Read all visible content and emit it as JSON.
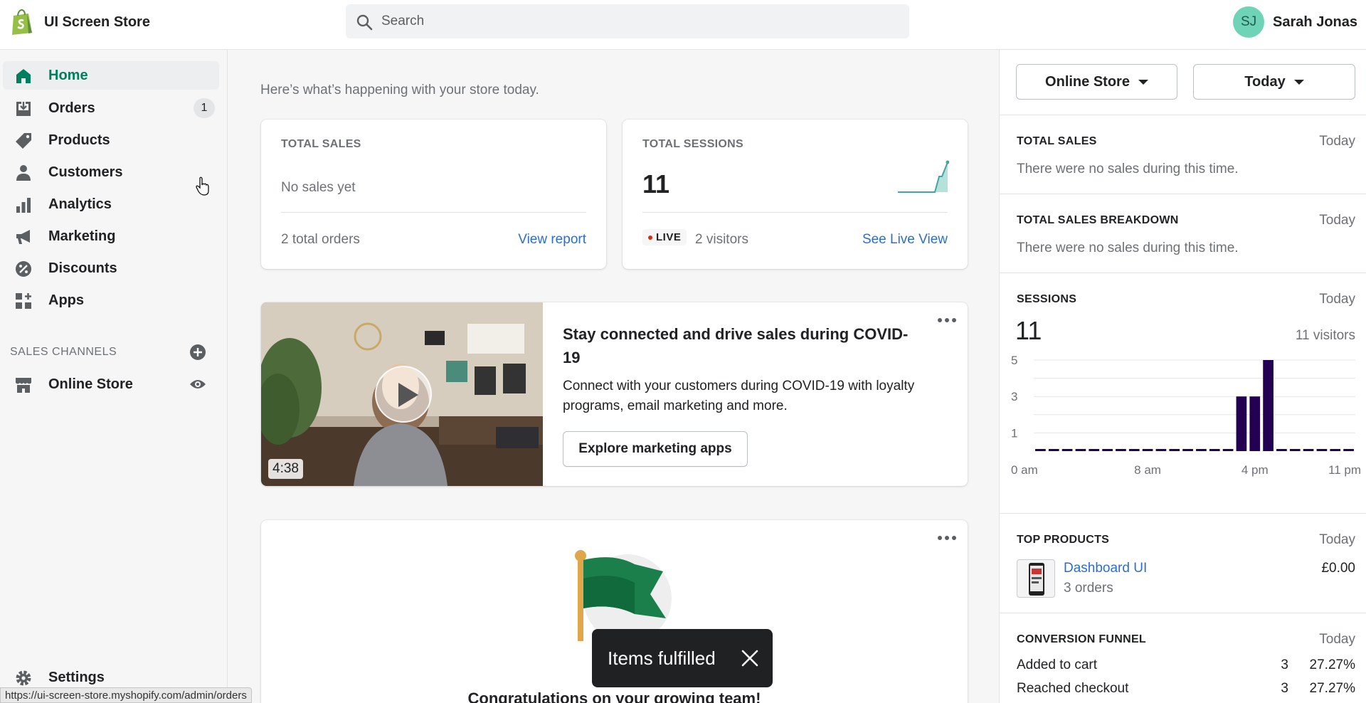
{
  "topbar": {
    "store_name": "UI Screen Store",
    "search_placeholder": "Search",
    "user_initials": "SJ",
    "user_name": "Sarah Jonas"
  },
  "sidebar": {
    "items": [
      {
        "label": "Home",
        "icon": "home-icon"
      },
      {
        "label": "Orders",
        "icon": "orders-icon",
        "badge": "1"
      },
      {
        "label": "Products",
        "icon": "tag-icon"
      },
      {
        "label": "Customers",
        "icon": "person-icon"
      },
      {
        "label": "Analytics",
        "icon": "bar-chart-icon"
      },
      {
        "label": "Marketing",
        "icon": "megaphone-icon"
      },
      {
        "label": "Discounts",
        "icon": "discount-icon"
      },
      {
        "label": "Apps",
        "icon": "apps-icon"
      }
    ],
    "sales_channels_label": "SALES CHANNELS",
    "online_store_label": "Online Store",
    "settings_label": "Settings"
  },
  "main": {
    "intro": "Here’s what’s happening with your store today.",
    "total_sales": {
      "heading": "TOTAL SALES",
      "value": "No sales yet",
      "orders": "2 total orders",
      "link": "View report"
    },
    "total_sessions": {
      "heading": "TOTAL SESSIONS",
      "value": "11",
      "live": "LIVE",
      "visitors": "2 visitors",
      "link": "See Live View"
    },
    "promo": {
      "duration": "4:38",
      "title": "Stay connected and drive sales during COVID-19",
      "body": "Connect with your customers during COVID-19 with loyalty programs, email marketing and more.",
      "button": "Explore marketing apps"
    },
    "team_card": {
      "title": "Congratulations on your growing team!"
    }
  },
  "toast": {
    "text": "Items fulfilled"
  },
  "statusbar": {
    "url": "https://ui-screen-store.myshopify.com/admin/orders"
  },
  "right_panel": {
    "channel_filter": "Online Store",
    "date_filter": "Today",
    "total_sales": {
      "heading": "TOTAL SALES",
      "date": "Today",
      "text": "There were no sales during this time."
    },
    "breakdown": {
      "heading": "TOTAL SALES BREAKDOWN",
      "date": "Today",
      "text": "There were no sales during this time."
    },
    "sessions": {
      "heading": "SESSIONS",
      "date": "Today",
      "value": "11",
      "visitors": "11 visitors"
    },
    "top_products": {
      "heading": "TOP PRODUCTS",
      "date": "Today",
      "product_name": "Dashboard UI",
      "product_orders": "3 orders",
      "product_price": "£0.00"
    },
    "conversion": {
      "heading": "CONVERSION FUNNEL",
      "date": "Today",
      "rows": [
        {
          "label": "Added to cart",
          "count": "3",
          "percent": "27.27%"
        },
        {
          "label": "Reached checkout",
          "count": "3",
          "percent": "27.27%"
        }
      ]
    }
  },
  "chart_data": {
    "type": "bar",
    "title": "",
    "x": [
      0,
      1,
      2,
      3,
      4,
      5,
      6,
      7,
      8,
      9,
      10,
      11,
      12,
      13,
      14,
      15,
      16,
      17,
      18,
      19,
      20,
      21,
      22,
      23
    ],
    "values": [
      0,
      0,
      0,
      0,
      0,
      0,
      0,
      0,
      0,
      0,
      0,
      0,
      0,
      0,
      0,
      3,
      3,
      5,
      0,
      0,
      0,
      0,
      0,
      0
    ],
    "ylim": [
      0,
      5
    ],
    "y_ticks": [
      "1",
      "3",
      "5"
    ],
    "x_tick_labels": [
      "0 am",
      "8 am",
      "4 pm",
      "11 pm"
    ],
    "bar_color": "#230051",
    "grid": true
  }
}
